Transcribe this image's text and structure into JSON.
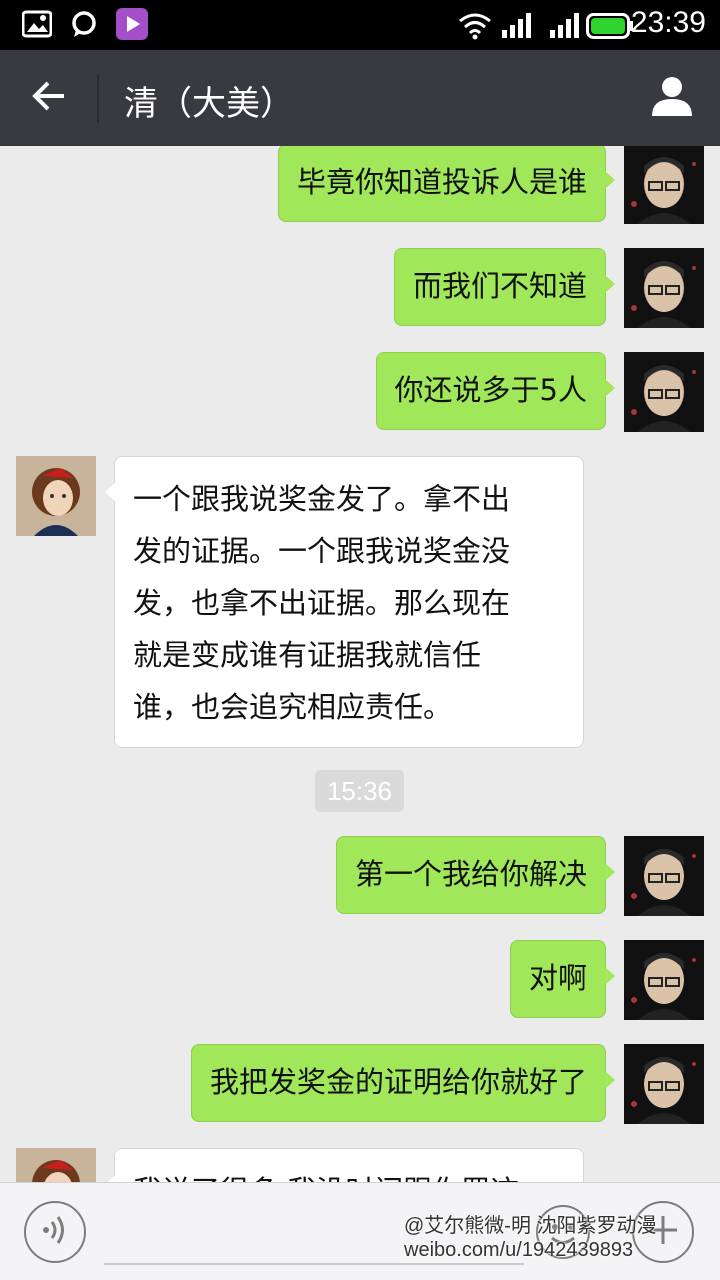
{
  "status_bar": {
    "time": "23:39",
    "icons": [
      "gallery-icon",
      "chat-notification-icon",
      "media-player-icon",
      "wifi-icon",
      "cell-signal-icon",
      "cell-signal-icon",
      "battery-icon"
    ]
  },
  "title_bar": {
    "title": "清（大美）",
    "back_icon": "back-arrow-icon",
    "contact_icon": "contact-info-icon"
  },
  "messages": [
    {
      "sender": "me",
      "text": "毕竟你知道投诉人是谁"
    },
    {
      "sender": "me",
      "text": "而我们不知道"
    },
    {
      "sender": "me",
      "text": "你还说多于5人"
    },
    {
      "sender": "other",
      "lines": [
        "一个跟我说奖金发了。拿不出",
        "发的证据。一个跟我说奖金没",
        "发，也拿不出证据。那么现在",
        "就是变成谁有证据我就信任",
        "谁，也会追究相应责任。"
      ]
    },
    {
      "sender": "me",
      "text": "第一个我给你解决"
    },
    {
      "sender": "me",
      "text": "对啊"
    },
    {
      "sender": "me",
      "text": "我把发奖金的证明给你就好了"
    },
    {
      "sender": "other",
      "lines": [
        "我说了很多 我没时间跟你罗这"
      ]
    }
  ],
  "timestamp": "15:36",
  "bottom_bar": {
    "voice_icon": "voice-input-icon",
    "emoji_icon": "emoji-icon",
    "plus_icon": "plus-icon"
  },
  "watermark": {
    "line1": "@艾尔熊微-明 沈阳紫罗动漫",
    "line2": "weibo.com/u/1942439893"
  },
  "colors": {
    "status_bar": "#000000",
    "title_bar": "#393a3f",
    "chat_background": "#ebebeb",
    "my_bubble": "#a0e75a",
    "other_bubble": "#ffffff"
  }
}
